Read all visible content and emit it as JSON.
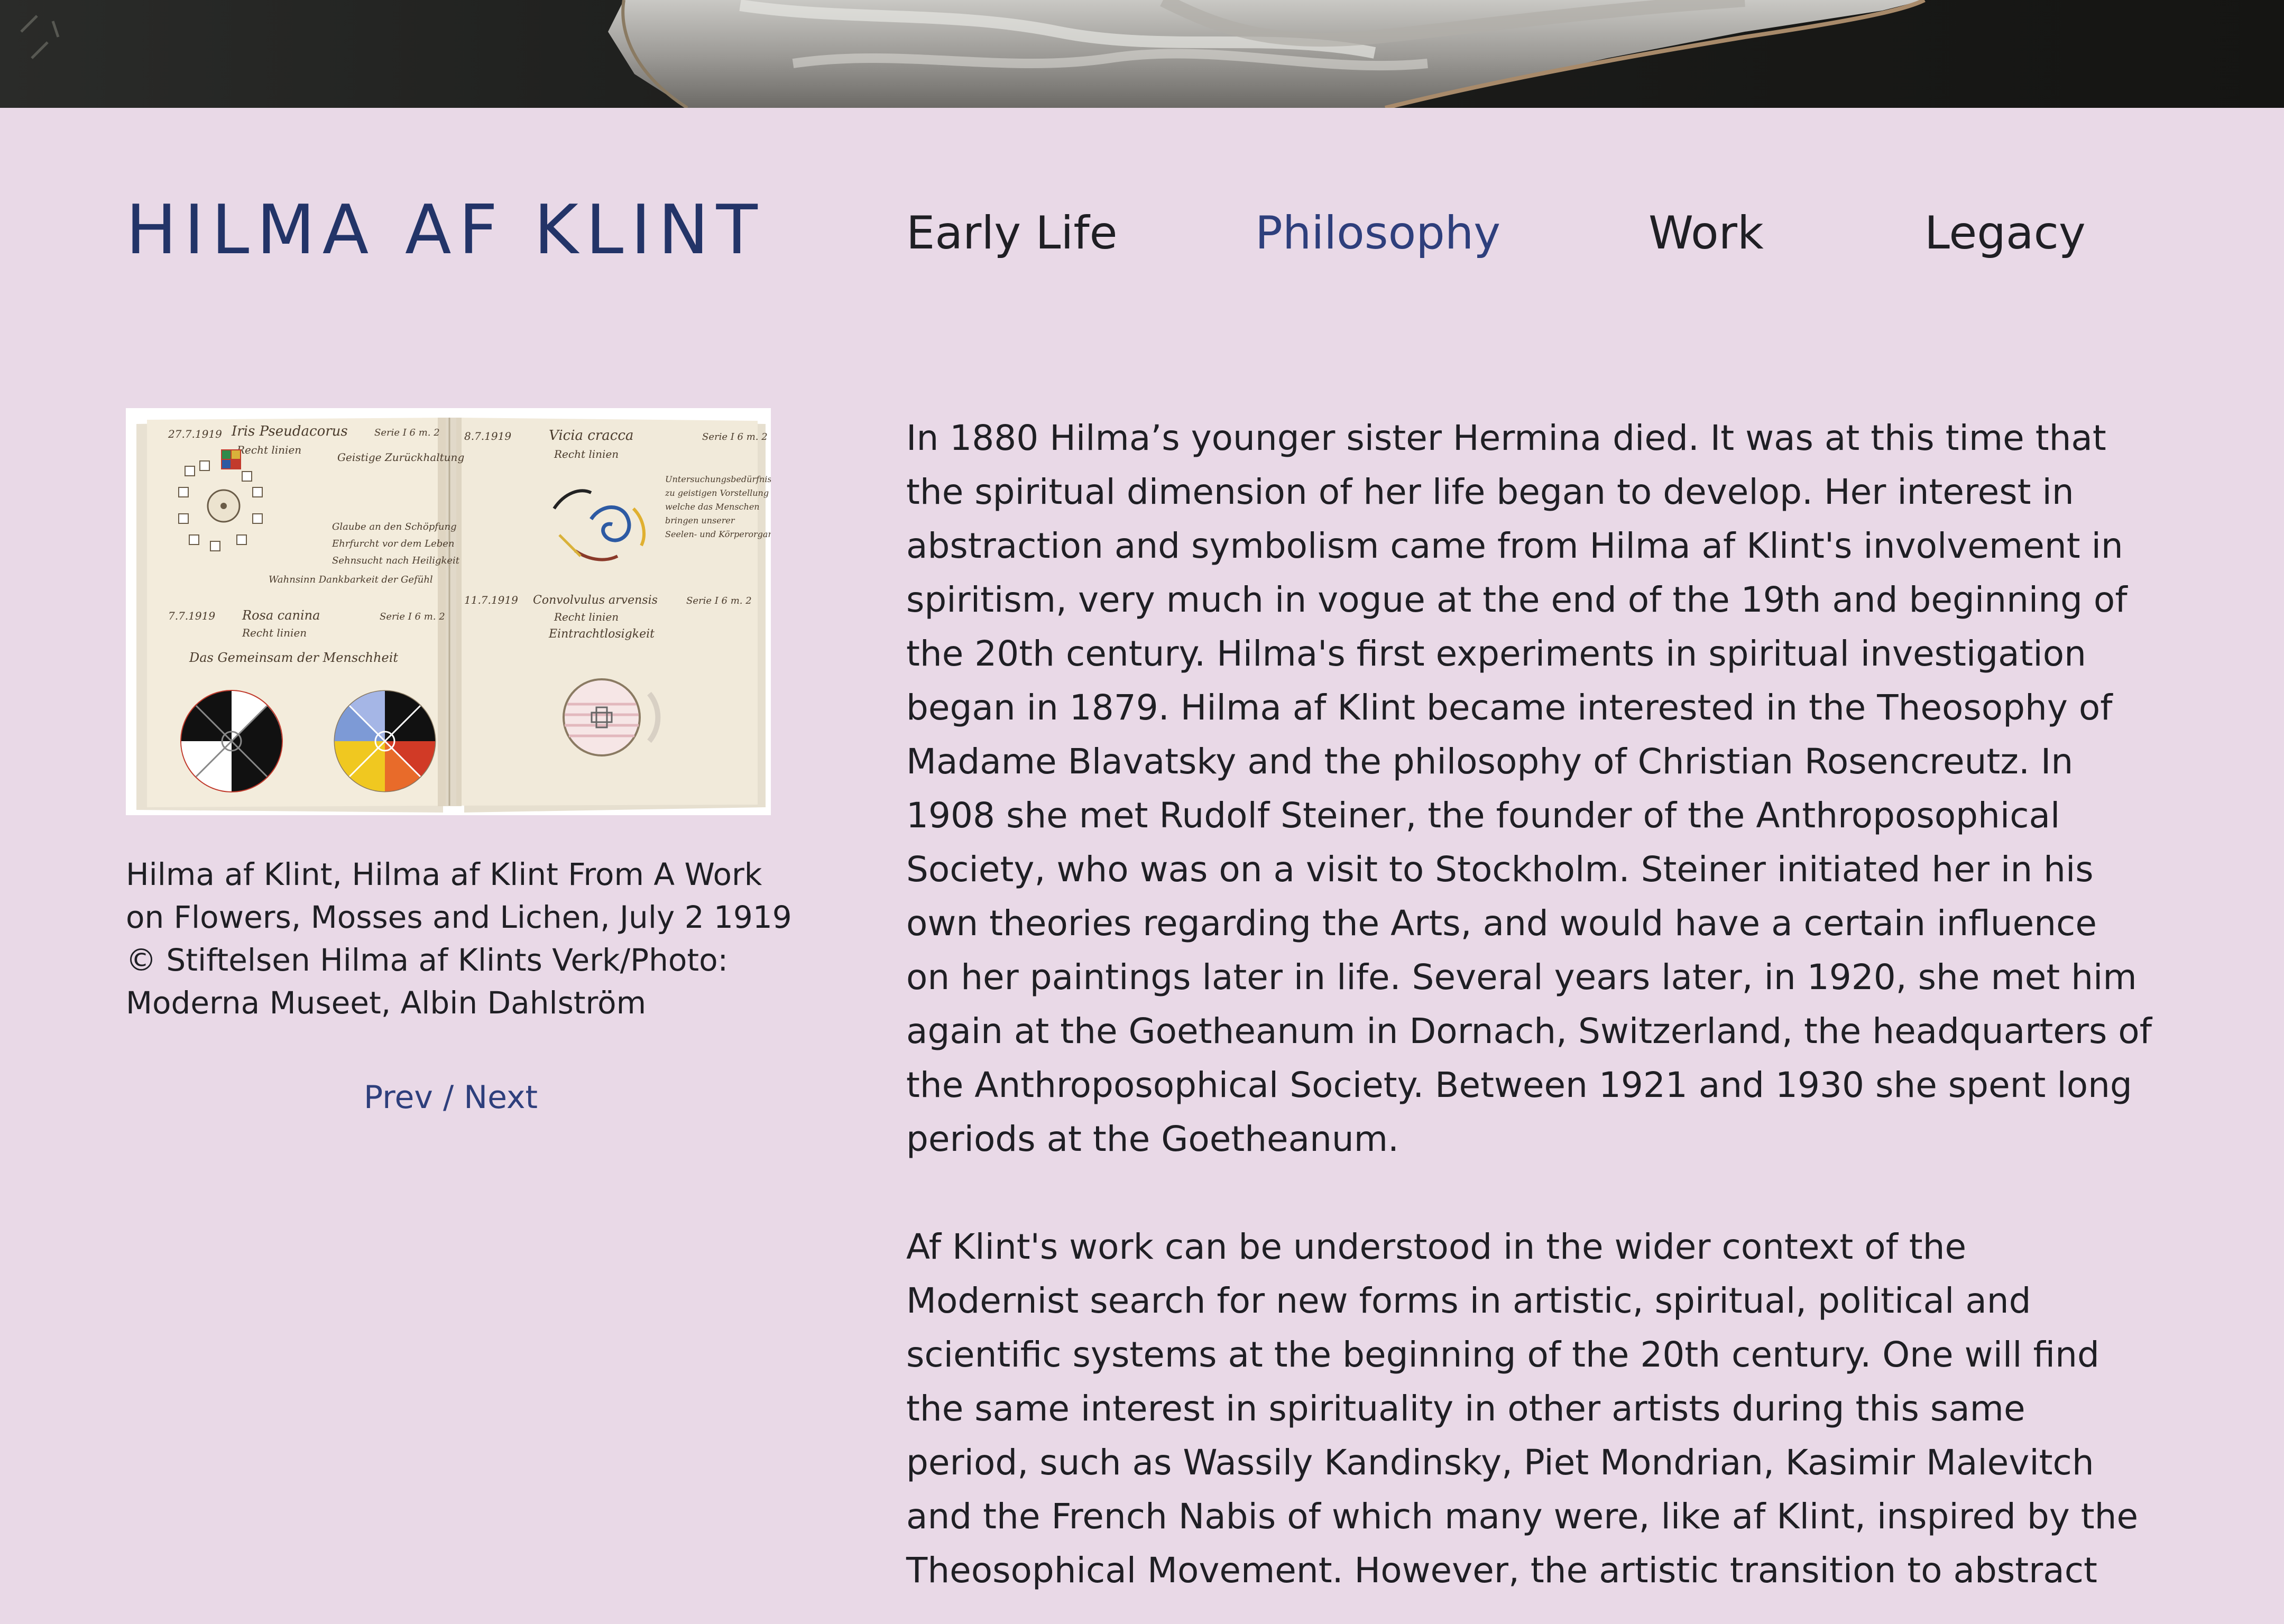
{
  "site": {
    "logo": "HILMA AF KLINT"
  },
  "nav": {
    "items": [
      {
        "label": "Early Life",
        "active": false
      },
      {
        "label": "Philosophy",
        "active": true
      },
      {
        "label": "Work",
        "active": false
      },
      {
        "label": "Legacy",
        "active": false
      }
    ]
  },
  "figure": {
    "caption_lines": [
      "Hilma af Klint, Hilma af Klint From A Work",
      "on Flowers, Mosses and Lichen, July 2 1919",
      "© Stiftelsen Hilma af Klints Verk/Photo:",
      "Moderna Museet, Albin Dahlström"
    ],
    "pager": {
      "prev": "Prev",
      "separator": " / ",
      "next": "Next"
    },
    "notebook_text": {
      "left_date_1": "27.7.1919",
      "left_title_1": "Iris Pseudacorus",
      "left_series_1": "Serie I 6 m. 2",
      "left_sub_1": "Recht linien",
      "left_note_1": "Geistige Zurückhaltung",
      "left_date_2": "7.7.1919",
      "left_title_2": "Rosa canina",
      "left_series_2": "Serie I 6 m. 2",
      "left_sub_2": "Recht linien",
      "left_line_2": "Das Gemeinsam der Menschheit",
      "right_date_1": "8.7.1919",
      "right_title_1": "Vicia cracca",
      "right_series_1": "Serie I 6 m. 2",
      "right_sub_1": "Recht linien",
      "right_date_2": "11.7.1919",
      "right_title_2": "Convolvulus arvensis",
      "right_series_2": "Serie I 6 m. 2",
      "right_sub_2": "Recht linien"
    }
  },
  "article": {
    "paragraphs": [
      [
        "In 1880 Hilma’s younger sister Hermina died. It was at this time that",
        "the spiritual dimension of her life began to develop. Her interest in",
        "abstraction and symbolism came from Hilma af Klint's involvement in",
        "spiritism, very much in vogue at the end of the 19th and beginning of",
        "the 20th century. Hilma's first experiments in spiritual investigation",
        "began in 1879. Hilma af Klint became interested in the Theosophy of",
        "Madame Blavatsky and the philosophy of Christian Rosencreutz. In",
        "1908 she met Rudolf Steiner, the founder of the Anthroposophical",
        "Society, who was on a visit to Stockholm. Steiner initiated her in his",
        "own theories regarding the Arts, and would have a certain influence",
        "on her paintings later in life. Several years later, in 1920, she met him",
        "again at the Goetheanum in Dornach, Switzerland, the headquarters of",
        "the Anthroposophical Society. Between 1921 and 1930 she spent long",
        "periods at the Goetheanum."
      ],
      [
        "Af Klint's work can be understood in the wider context of the",
        "Modernist search for new forms in artistic, spiritual, political and",
        "scientific systems at the beginning of the 20th century. One will find",
        "the same interest in spirituality in other artists during this same",
        "period, such as Wassily Kandinsky, Piet Mondrian, Kasimir Malevitch",
        "and the French Nabis of which many were, like af Klint, inspired by the",
        "Theosophical Movement. However, the artistic transition to abstract"
      ]
    ]
  },
  "colors": {
    "background": "#e9d9e7",
    "accent": "#2e3f7c",
    "logo": "#233468",
    "text": "#1f1f24"
  }
}
